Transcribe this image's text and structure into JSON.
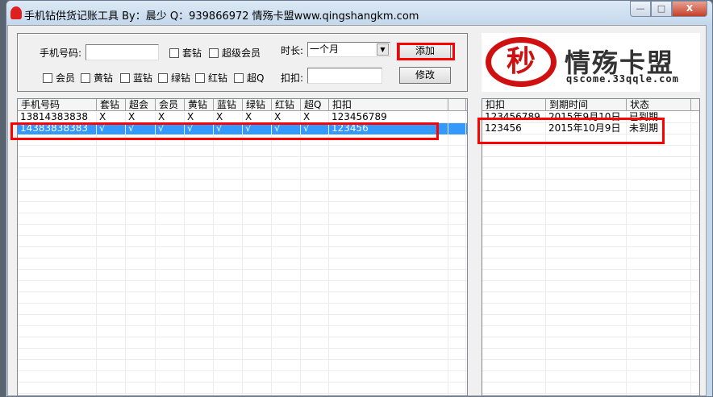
{
  "window": {
    "title": "手机钻供货记账工具 By：晨少 Q：939866972 情殇卡盟www.qingshangkm.com",
    "minimize": "—",
    "maximize": "□",
    "close": "X"
  },
  "form": {
    "phone_label": "手机号码:",
    "phone_value": "",
    "duration_label": "时长:",
    "duration_value": "一个月",
    "qq_label": "扣扣:",
    "qq_value": "",
    "add_label": "添加",
    "modify_label": "修改",
    "checkboxes_row1": [
      "套钻",
      "超级会员"
    ],
    "checkboxes_row2": [
      "会员",
      "黄钻",
      "蓝钻",
      "绿钻",
      "红钻",
      "超Q"
    ]
  },
  "logo": {
    "text": "情殇卡盟",
    "glyph": "秒",
    "url": "qscome.33qqle.com"
  },
  "main_table": {
    "columns": [
      "手机号码",
      "套钻",
      "超会",
      "会员",
      "黄钻",
      "蓝钻",
      "绿钻",
      "红钻",
      "超Q",
      "扣扣"
    ],
    "rows": [
      [
        "13814383838",
        "X",
        "X",
        "X",
        "X",
        "X",
        "X",
        "X",
        "X",
        "123456789"
      ],
      [
        "14383838383",
        "√",
        "√",
        "√",
        "√",
        "√",
        "√",
        "√",
        "√",
        "123456"
      ]
    ],
    "selected": 1
  },
  "expiry_table": {
    "columns": [
      "扣扣",
      "到期时间",
      "状态"
    ],
    "rows": [
      [
        "123456789",
        "2015年9月10日",
        "已到期"
      ],
      [
        "123456",
        "2015年10月9日",
        "未到期"
      ]
    ]
  },
  "colors": {
    "selection": "#3399ff",
    "highlight": "#ff0000",
    "logo_red": "#d01010"
  }
}
